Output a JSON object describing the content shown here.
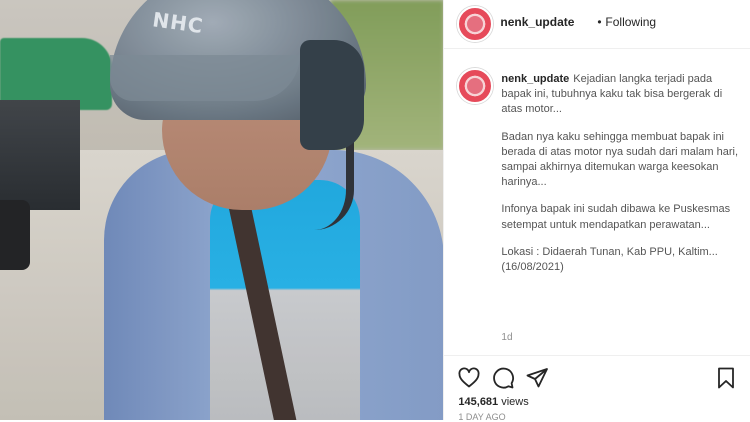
{
  "media": {
    "helmet_brand": "NHC"
  },
  "header": {
    "username": "nenk_update",
    "separator": "•",
    "follow_status": "Following"
  },
  "caption": {
    "username": "nenk_update",
    "paragraphs": [
      "Kejadian langka terjadi pada bapak ini, tubuhnya kaku tak bisa bergerak di atas motor...",
      "Badan nya kaku sehingga membuat bapak ini berada di atas motor nya sudah dari malam hari, sampai akhirnya ditemukan warga keesokan harinya...",
      "Infonya bapak ini sudah dibawa ke Puskesmas setempat untuk mendapatkan perawatan...",
      "Lokasi : Didaerah Tunan, Kab PPU, Kaltim... (16/08/2021)"
    ],
    "time_ago": "1d"
  },
  "actions": {
    "icons": [
      "heart-icon",
      "comment-icon",
      "share-icon",
      "bookmark-icon"
    ],
    "views_count": "145,681",
    "views_label": "views",
    "sub_text": "1 DAY AGO"
  }
}
